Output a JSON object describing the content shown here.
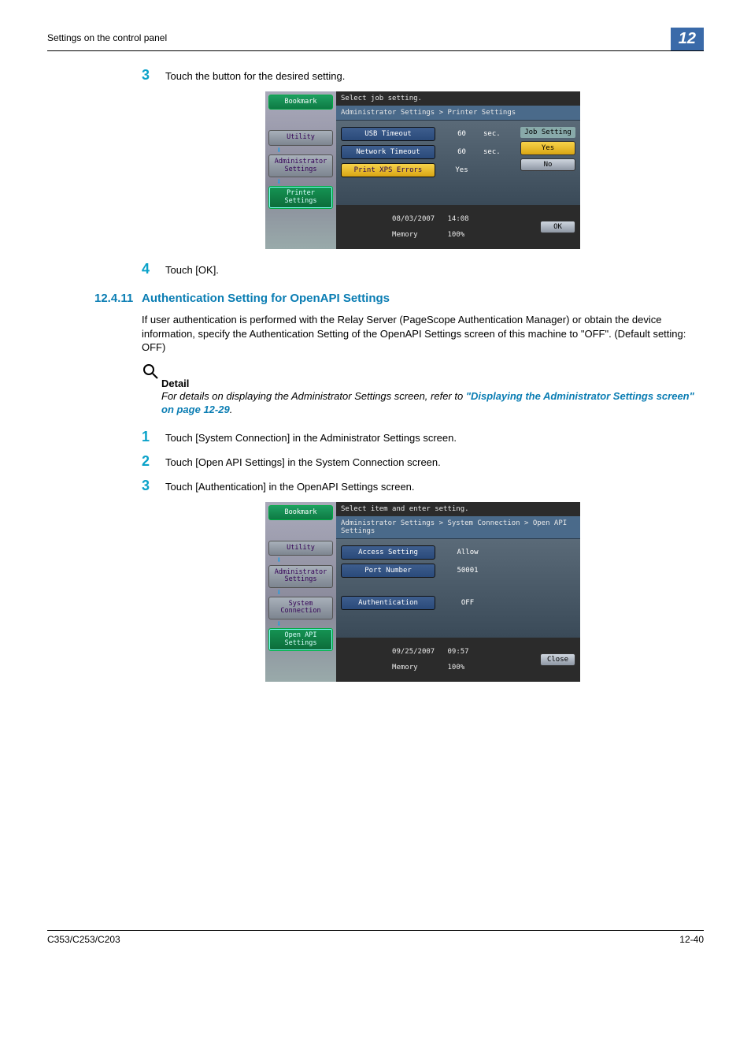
{
  "header": {
    "section_title": "Settings on the control panel",
    "chapter_num": "12"
  },
  "step3": {
    "num": "3",
    "text": "Touch the button for the desired setting."
  },
  "screenshot1": {
    "topbar": "Select job setting.",
    "breadcrumb": "Administrator Settings > Printer Settings",
    "side": {
      "bookmark": "Bookmark",
      "utility": "Utility",
      "admin": "Administrator\nSettings",
      "printer": "Printer Settings"
    },
    "rows": [
      {
        "label": "USB Timeout",
        "value": "60",
        "unit": "sec."
      },
      {
        "label": "Network Timeout",
        "value": "60",
        "unit": "sec."
      },
      {
        "label": "Print XPS Errors",
        "value": "Yes",
        "unit": ""
      }
    ],
    "rightcol": {
      "title": "Job Setting",
      "yes": "Yes",
      "no": "No"
    },
    "status": {
      "date": "08/03/2007",
      "time": "14:08",
      "memL": "Memory",
      "memV": "100%",
      "ok": "OK"
    }
  },
  "step4": {
    "num": "4",
    "text": "Touch [OK]."
  },
  "section": {
    "num": "12.4.11",
    "title": "Authentication Setting for OpenAPI Settings"
  },
  "para1": "If user authentication is performed with the Relay Server (PageScope Authentication Manager) or obtain the device information, specify the Authentication Setting of the OpenAPI Settings screen of this machine to \"OFF\". (Default setting: OFF)",
  "detail": {
    "title": "Detail",
    "body_pre": "For details on displaying the Administrator Settings screen, refer to ",
    "link": "\"Displaying the Administrator Settings screen\" on page 12-29",
    "period": "."
  },
  "step1b": {
    "num": "1",
    "text": "Touch [System Connection] in the Administrator Settings screen."
  },
  "step2b": {
    "num": "2",
    "text": "Touch [Open API Settings] in the System Connection screen."
  },
  "step3b": {
    "num": "3",
    "text": "Touch [Authentication] in the OpenAPI Settings screen."
  },
  "screenshot2": {
    "topbar": "Select item and enter setting.",
    "breadcrumb": "Administrator Settings > System Connection > Open API Settings",
    "side": {
      "bookmark": "Bookmark",
      "utility": "Utility",
      "admin": "Administrator\nSettings",
      "system": "System\nConnection",
      "openapi": "Open API\nSettings"
    },
    "rows": [
      {
        "label": "Access Setting",
        "value": "Allow"
      },
      {
        "label": "Port Number",
        "value": "50001"
      },
      {
        "label": "Authentication",
        "value": "OFF"
      }
    ],
    "status": {
      "date": "09/25/2007",
      "time": "09:57",
      "memL": "Memory",
      "memV": "100%",
      "close": "Close"
    }
  },
  "footer": {
    "left": "C353/C253/C203",
    "right": "12-40"
  }
}
